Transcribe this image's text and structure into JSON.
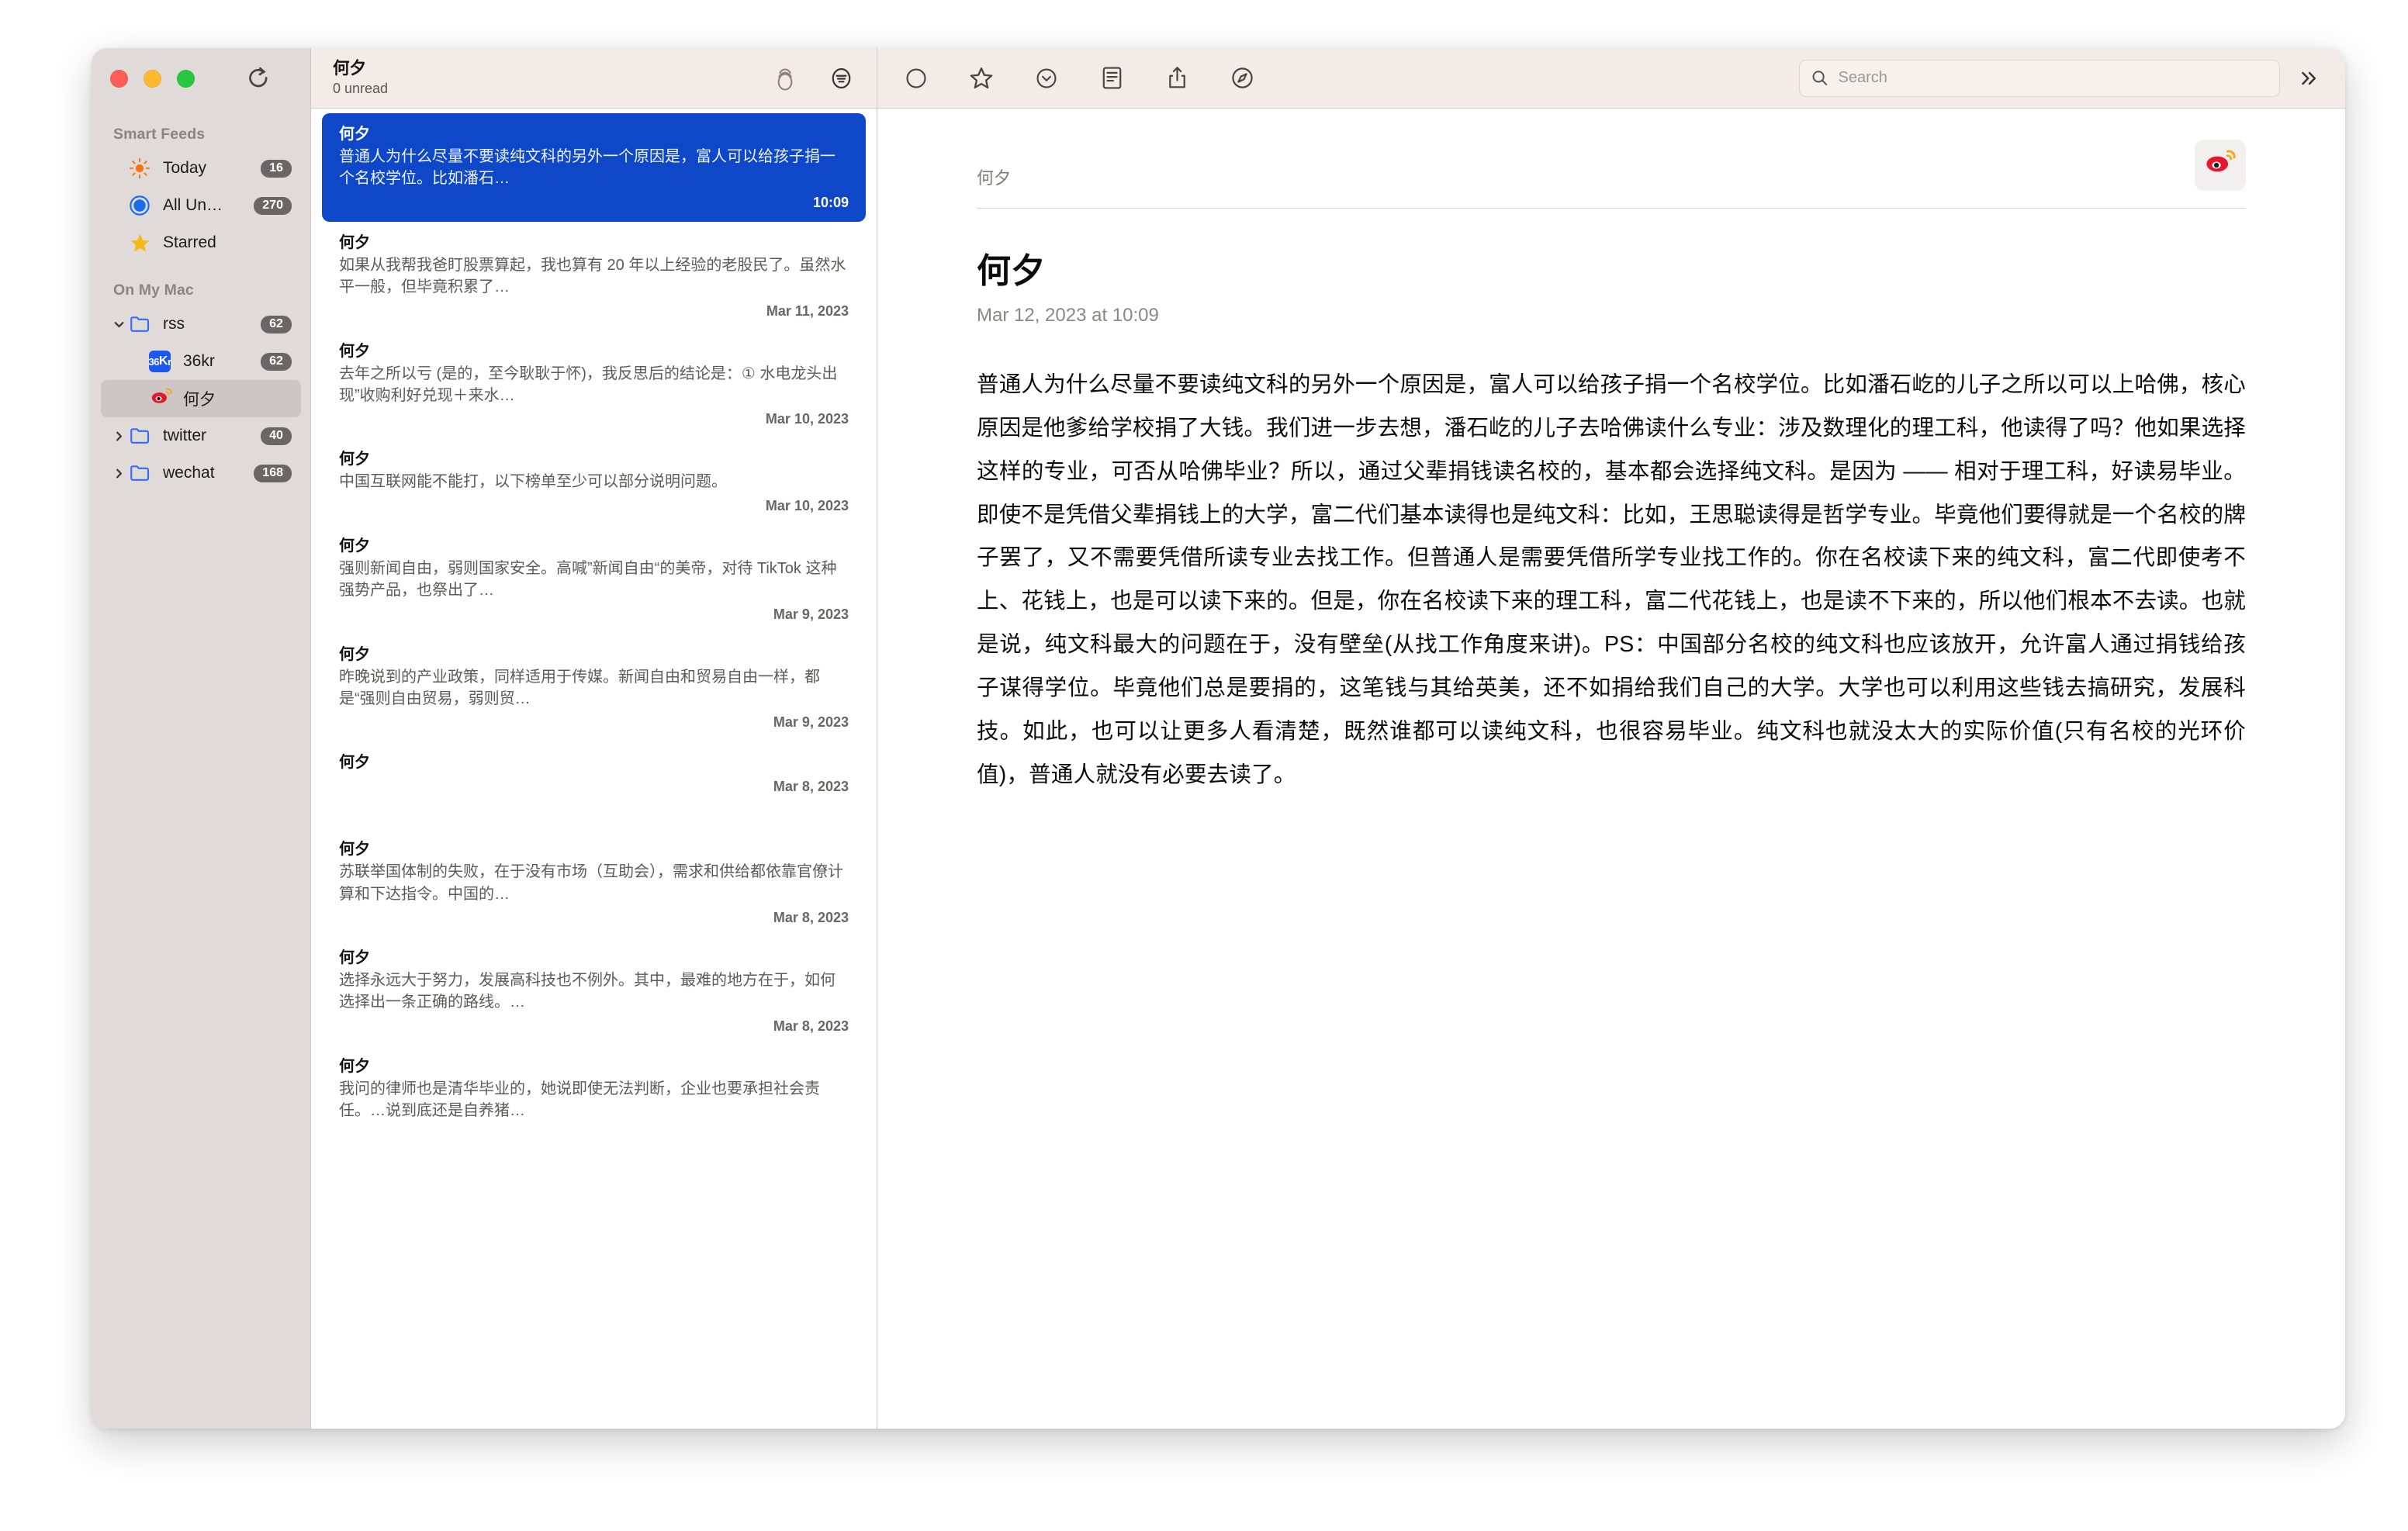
{
  "window": {
    "traffic_lights": [
      "close",
      "minimize",
      "zoom"
    ],
    "refresh_label": "Refresh"
  },
  "sidebar": {
    "sections": [
      {
        "title": "Smart Feeds",
        "items": [
          {
            "label": "Today",
            "count": "16",
            "icon": "sun-icon",
            "kind": "smart",
            "selected": false
          },
          {
            "label": "All Un…",
            "count": "270",
            "icon": "unread-circle-icon",
            "kind": "smart",
            "selected": false
          },
          {
            "label": "Starred",
            "count": "",
            "icon": "star-icon",
            "kind": "smart",
            "selected": false
          }
        ]
      },
      {
        "title": "On My Mac",
        "items": [
          {
            "label": "rss",
            "count": "62",
            "icon": "folder-icon",
            "kind": "folder",
            "twisty": "down",
            "selected": false
          },
          {
            "label": "36kr",
            "count": "62",
            "icon": "36kr-favicon",
            "kind": "feed",
            "twisty": "",
            "selected": false
          },
          {
            "label": "何夕",
            "count": "",
            "icon": "weibo-favicon",
            "kind": "feed",
            "twisty": "",
            "selected": true
          },
          {
            "label": "twitter",
            "count": "40",
            "icon": "folder-icon",
            "kind": "folder",
            "twisty": "right",
            "selected": false
          },
          {
            "label": "wechat",
            "count": "168",
            "icon": "folder-icon",
            "kind": "folder",
            "twisty": "right",
            "selected": false
          }
        ]
      }
    ]
  },
  "list_header": {
    "title": "何夕",
    "unread": "0 unread",
    "actions": [
      {
        "name": "mark-all-read-icon",
        "label": "Mark All as Read"
      },
      {
        "name": "filter-icon",
        "label": "Filter"
      }
    ]
  },
  "article_list": [
    {
      "feed": "何夕",
      "summary": "普通人为什么尽量不要读纯文科的另外一个原因是，富人可以给孩子捐一个名校学位。比如潘石…",
      "date": "10:09",
      "selected": true
    },
    {
      "feed": "何夕",
      "summary": "如果从我帮我爸盯股票算起，我也算有 20 年以上经验的老股民了。虽然水平一般，但毕竟积累了…",
      "date": "Mar 11, 2023",
      "selected": false
    },
    {
      "feed": "何夕",
      "summary": "去年之所以亏 (是的，至今耿耿于怀)，我反思后的结论是：① 水电龙头出现”收购利好兑现＋来水…",
      "date": "Mar 10, 2023",
      "selected": false
    },
    {
      "feed": "何夕",
      "summary": "中国互联网能不能打，以下榜单至少可以部分说明问题。",
      "date": "Mar 10, 2023",
      "selected": false
    },
    {
      "feed": "何夕",
      "summary": "强则新闻自由，弱则国家安全。高喊”新闻自由“的美帝，对待 TikTok 这种强势产品，也祭出了…",
      "date": "Mar 9, 2023",
      "selected": false
    },
    {
      "feed": "何夕",
      "summary": "昨晚说到的产业政策，同样适用于传媒。新闻自由和贸易自由一样，都是“强则自由贸易，弱则贸…",
      "date": "Mar 9, 2023",
      "selected": false
    },
    {
      "feed": "何夕",
      "summary": "",
      "date": "Mar 8, 2023",
      "selected": false
    },
    {
      "feed": "何夕",
      "summary": "苏联举国体制的失败，在于没有市场（互助会），需求和供给都依靠官僚计算和下达指令。中国的…",
      "date": "Mar 8, 2023",
      "selected": false
    },
    {
      "feed": "何夕",
      "summary": "选择永远大于努力，发展高科技也不例外。其中，最难的地方在于，如何选择出一条正确的路线。…",
      "date": "Mar 8, 2023",
      "selected": false
    },
    {
      "feed": "何夕",
      "summary": "我问的律师也是清华毕业的，她说即使无法判断，企业也要承担社会责任。…说到底还是自养猪…",
      "date": "",
      "selected": false
    }
  ],
  "detail_toolbar": {
    "buttons": [
      {
        "name": "mark-unread-icon",
        "label": "Mark as Unread"
      },
      {
        "name": "star-icon",
        "label": "Star"
      },
      {
        "name": "mark-below-read-icon",
        "label": "Mark Below as Read"
      },
      {
        "name": "reader-view-icon",
        "label": "Reader View"
      },
      {
        "name": "share-icon",
        "label": "Share"
      },
      {
        "name": "open-in-browser-icon",
        "label": "Open in Browser"
      }
    ],
    "search": {
      "value": "",
      "placeholder": "Search"
    },
    "overflow_label": "More"
  },
  "article": {
    "feed_name": "何夕",
    "avatar_icon": "weibo-favicon",
    "title": "何夕",
    "meta": "Mar 12, 2023 at 10:09",
    "body": "普通人为什么尽量不要读纯文科的另外一个原因是，富人可以给孩子捐一个名校学位。比如潘石屹的儿子之所以可以上哈佛，核心原因是他爹给学校捐了大钱。我们进一步去想，潘石屹的儿子去哈佛读什么专业：涉及数理化的理工科，他读得了吗？他如果选择这样的专业，可否从哈佛毕业？所以，通过父辈捐钱读名校的，基本都会选择纯文科。是因为 —— 相对于理工科，好读易毕业。即使不是凭借父辈捐钱上的大学，富二代们基本读得也是纯文科：比如，王思聪读得是哲学专业。毕竟他们要得就是一个名校的牌子罢了，又不需要凭借所读专业去找工作。但普通人是需要凭借所学专业找工作的。你在名校读下来的纯文科，富二代即使考不上、花钱上，也是可以读下来的。但是，你在名校读下来的理工科，富二代花钱上，也是读不下来的，所以他们根本不去读。也就是说，纯文科最大的问题在于，没有壁垒(从找工作角度来讲)。PS：中国部分名校的纯文科也应该放开，允许富人通过捐钱给孩子谋得学位。毕竟他们总是要捐的，这笔钱与其给英美，还不如捐给我们自己的大学。大学也可以利用这些钱去搞研究，发展科技。如此，也可以让更多人看清楚，既然谁都可以读纯文科，也很容易毕业。纯文科也就没太大的实际价值(只有名校的光环价值)，普通人就没有必要去读了。"
  },
  "colors": {
    "sidebar_bg": "#e0dad9",
    "toolbar_bg": "#f3ebe8",
    "selection_blue": "#0f47c9",
    "badge_gray": "#6b6564",
    "accent_orange": "#f97316",
    "star_yellow": "#f5b917",
    "folder_blue": "#2f6df6",
    "weibo_red": "#e6162d"
  }
}
